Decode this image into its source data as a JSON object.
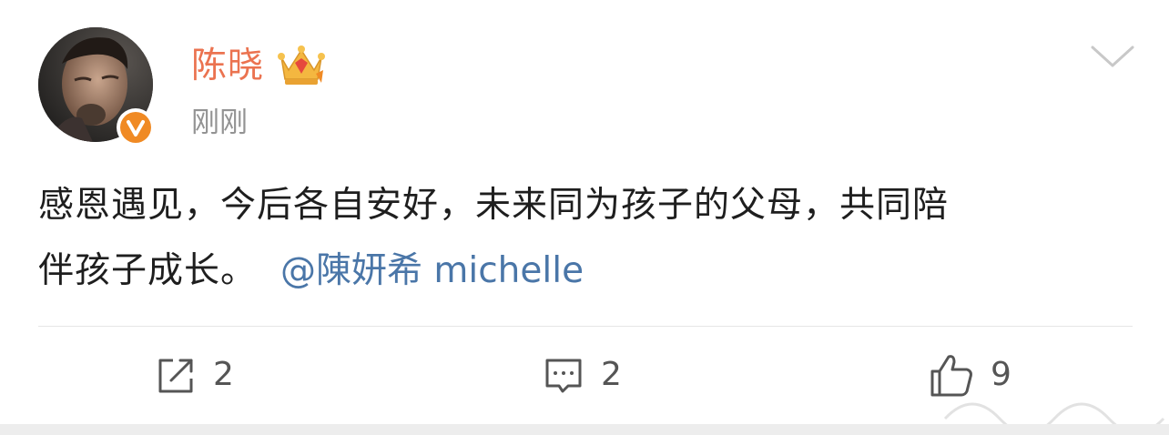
{
  "post": {
    "author_name": "陈晓",
    "timestamp": "刚刚",
    "text_line_1": "感恩遇见，今后各自安好，未来同为孩子的父母，共同陪",
    "text_line_2": "伴孩子成长。",
    "mention": "@陳妍希 michelle"
  },
  "icons": {
    "avatar": "user-avatar",
    "verified": "verified-check-icon",
    "crown": "crown-badge-icon",
    "menu": "chevron-down-icon",
    "repost": "share-icon",
    "comment": "comment-icon",
    "like": "thumbs-up-icon"
  },
  "actions": {
    "repost_count": "2",
    "comment_count": "2",
    "like_count": "9"
  },
  "colors": {
    "author_name": "#eb7350",
    "verified_badge": "#f08a24",
    "mention_link": "#4a76a8",
    "body_text": "#1e1e1e",
    "muted_text": "#939393"
  }
}
